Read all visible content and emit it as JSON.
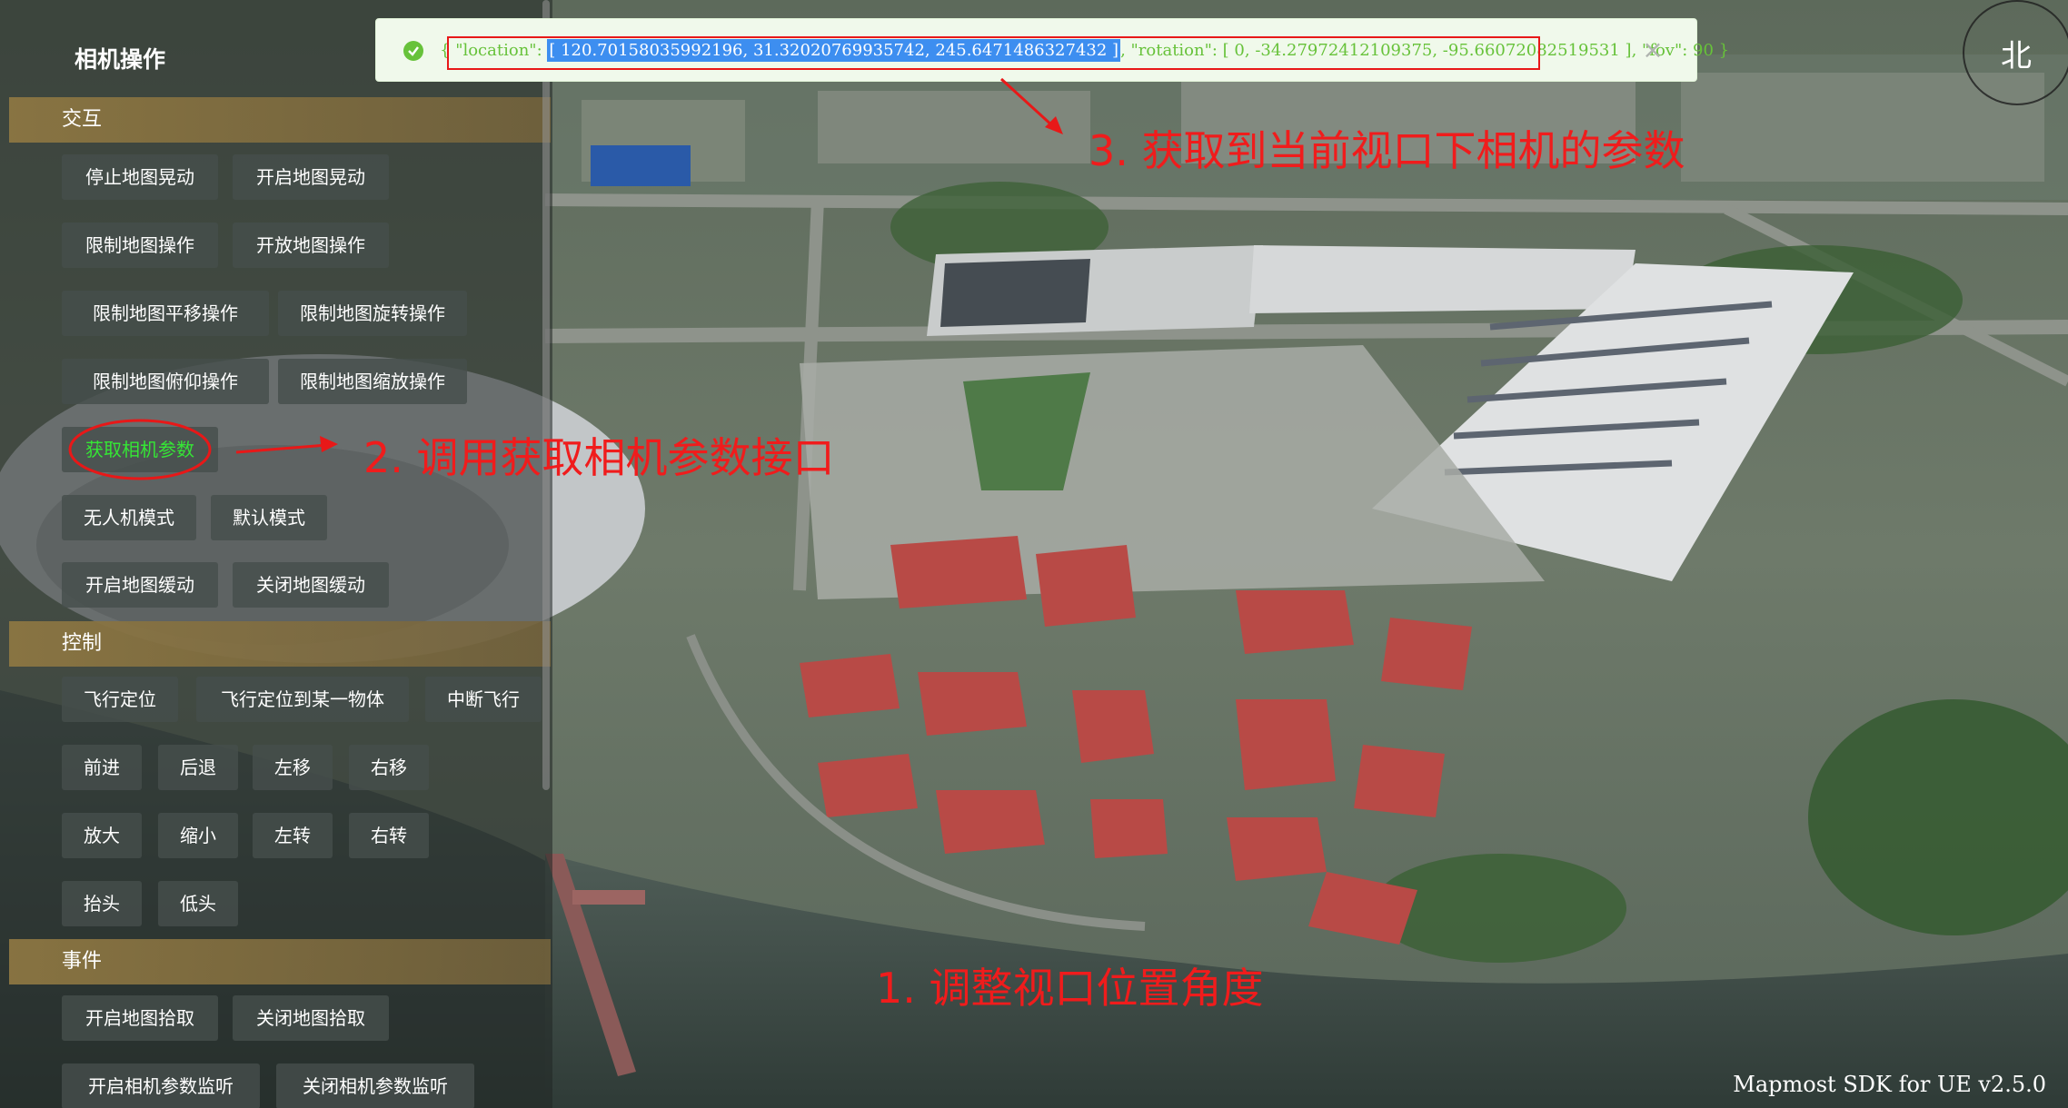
{
  "panel": {
    "title": "相机操作",
    "sections": [
      {
        "header": "交互",
        "buttons": [
          "停止地图晃动",
          "开启地图晃动",
          "限制地图操作",
          "开放地图操作",
          "限制地图平移操作",
          "限制地图旋转操作",
          "限制地图俯仰操作",
          "限制地图缩放操作",
          "获取相机参数",
          "无人机模式",
          "默认模式",
          "开启地图缓动",
          "关闭地图缓动"
        ]
      },
      {
        "header": "控制",
        "buttons": [
          "飞行定位",
          "飞行定位到某一物体",
          "中断飞行",
          "前进",
          "后退",
          "左移",
          "右移",
          "放大",
          "缩小",
          "左转",
          "右转",
          "抬头",
          "低头"
        ]
      },
      {
        "header": "事件",
        "buttons": [
          "开启地图拾取",
          "关闭地图拾取",
          "开启相机参数监听",
          "关闭相机参数监听"
        ]
      }
    ],
    "active_button": "获取相机参数"
  },
  "toast": {
    "prefix": "{ ",
    "location_key": "\"location\": ",
    "location_value": "[ 120.70158035992196, 31.32020769935742, 245.6471486327432 ]",
    "rest": ", \"rotation\": [ 0, -34.27972412109375, -95.66072082519531 ], \"fov\": 90 }",
    "icon": "success-check-icon",
    "close_icon": "close-icon"
  },
  "compass": {
    "label": "北"
  },
  "annotations": {
    "step1": "1. 调整视口位置角度",
    "step2": "2. 调用获取相机参数接口",
    "step3": "3. 获取到当前视口下相机的参数"
  },
  "footer": "Mapmost SDK for UE v2.5.0",
  "colors": {
    "accent_green": "#67c23a",
    "annotation_red": "#f01c1c",
    "section_gold": "#8c7642",
    "highlight_blue": "#3d8ef0"
  }
}
